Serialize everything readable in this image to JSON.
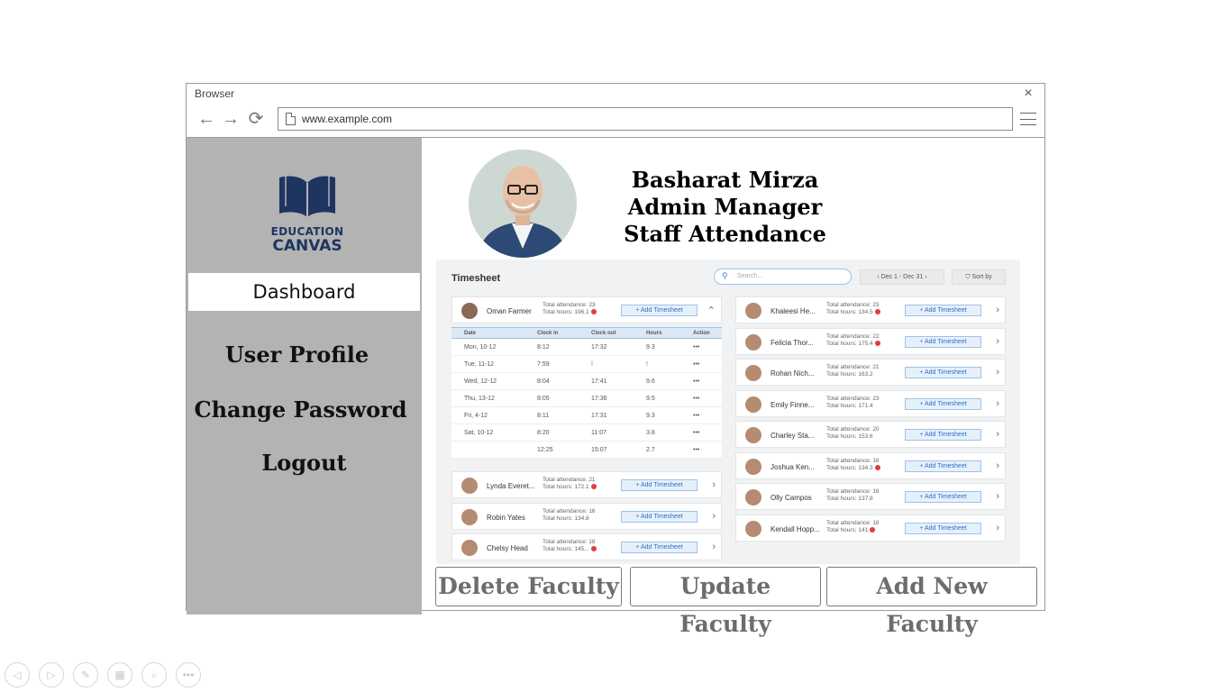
{
  "browser": {
    "title": "Browser",
    "url": "www.example.com",
    "close_glyph": "×",
    "back_glyph": "←",
    "forward_glyph": "→",
    "reload_glyph": "⟳"
  },
  "logo": {
    "line1": "EDUCATION",
    "line2": "CANVAS"
  },
  "sidebar": {
    "dashboard": "Dashboard",
    "user_profile": "User Profile",
    "change_password": "Change Password",
    "logout": "Logout"
  },
  "profile": {
    "name": "Basharat Mirza",
    "role": "Admin Manager",
    "section": "Staff Attendance"
  },
  "timesheet": {
    "title": "Timesheet",
    "search_placeholder": "Search...",
    "date_range": "‹  Dec 1 - Dec 31  ›",
    "sort_label": "⛉ Sort by",
    "add_label": "+ Add Timesheet",
    "expanded": {
      "name": "Oman Farmer",
      "attendance": "Total attendance: 23",
      "hours": "Total hours: 196.1"
    },
    "columns": [
      "Date",
      "Clock in",
      "Clock out",
      "Hours",
      "Action"
    ],
    "rows": [
      [
        "Mon, 10-12",
        "8:12",
        "17:32",
        "9.3",
        "•••"
      ],
      [
        "Tue, 11-12",
        "7:59",
        "!",
        "!",
        "•••"
      ],
      [
        "Wed, 12-12",
        "8:04",
        "17:41",
        "9.6",
        "•••"
      ],
      [
        "Thu, 13-12",
        "8:05",
        "17:36",
        "9.5",
        "•••"
      ],
      [
        "Fri, 4-12",
        "8:11",
        "17:31",
        "9.3",
        "•••"
      ],
      [
        "Sat, 10-12",
        "8:20",
        "11:07",
        "3.8",
        "•••"
      ],
      [
        "",
        "12:25",
        "15:07",
        "2.7",
        "•••"
      ]
    ],
    "left_cards": [
      {
        "name": "Lynda Everet...",
        "attendance": "Total attendance: 21",
        "hours": "Total hours: 172.1",
        "alert": true
      },
      {
        "name": "Robin Yates",
        "attendance": "Total attendance: 16",
        "hours": "Total hours: 134.8",
        "alert": false
      },
      {
        "name": "Chelsy Head",
        "attendance": "Total attendance: 18",
        "hours": "Total hours: 145...",
        "alert": true
      }
    ],
    "right_cards": [
      {
        "name": "Khaleesi He...",
        "attendance": "Total attendance: 23",
        "hours": "Total hours: 134.5",
        "alert": true
      },
      {
        "name": "Felicia Thor...",
        "attendance": "Total attendance: 22",
        "hours": "Total hours: 175.4",
        "alert": true
      },
      {
        "name": "Rohan Nich...",
        "attendance": "Total attendance: 21",
        "hours": "Total hours: 163.2",
        "alert": false
      },
      {
        "name": "Emily Finne...",
        "attendance": "Total attendance: 23",
        "hours": "Total hours: 171.4",
        "alert": false
      },
      {
        "name": "Charley Sta...",
        "attendance": "Total attendance: 20",
        "hours": "Total hours: 153.6",
        "alert": false
      },
      {
        "name": "Joshua Ken...",
        "attendance": "Total attendance: 18",
        "hours": "Total hours: 134.3",
        "alert": true
      },
      {
        "name": "Olly Campos",
        "attendance": "Total attendance: 18",
        "hours": "Total hours: 137.8",
        "alert": false
      },
      {
        "name": "Kendall Hopp...",
        "attendance": "Total attendance: 18",
        "hours": "Total hours: 141",
        "alert": true
      }
    ]
  },
  "actions": {
    "delete": "Delete Faculty",
    "update": "Update Faculty",
    "add": "Add New Faculty"
  },
  "slide_toolbar": [
    "◁",
    "▷",
    "✎",
    "▦",
    "⌕",
    "•••"
  ]
}
